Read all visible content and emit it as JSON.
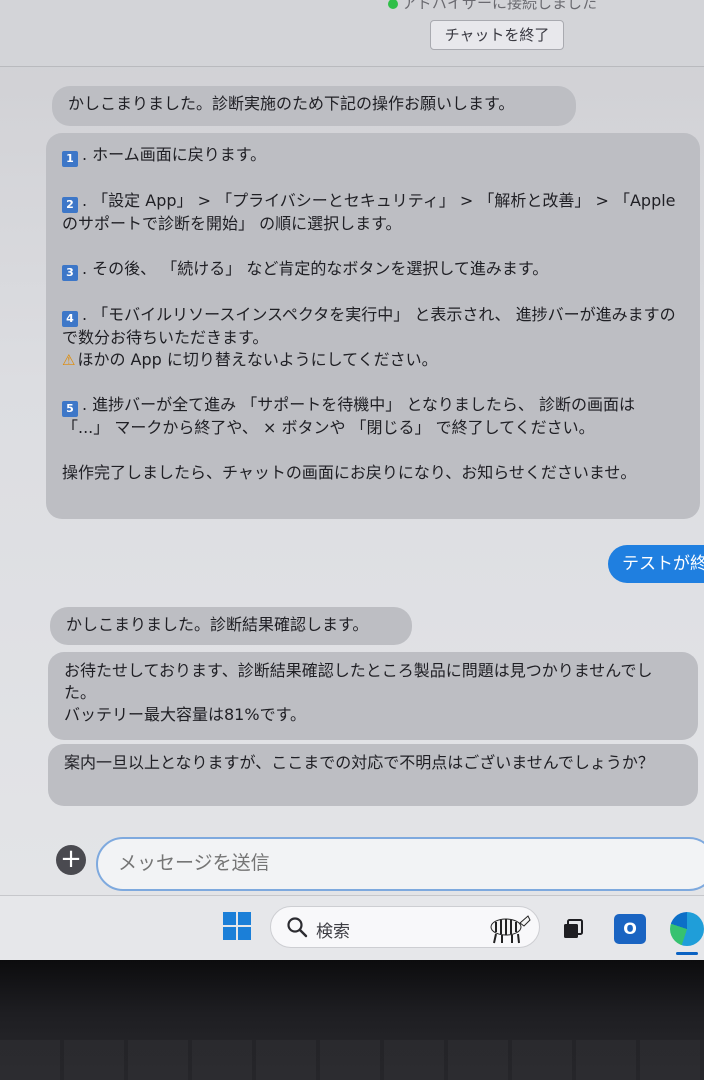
{
  "header": {
    "status_text": "アドバイザーに接続しました",
    "end_chat_label": "チャットを終了"
  },
  "messages": {
    "m1": "かしこまりました。診断実施のため下記の操作お願いします。",
    "steps": {
      "s1": {
        "num": "1",
        "text": ". ホーム画面に戻ります。"
      },
      "s2": {
        "num": "2",
        "text": ". 「設定 App」 > 「プライバシーとセキュリティ」 > 「解析と改善」 > 「Apple のサポートで診断を開始」 の順に選択します。"
      },
      "s3": {
        "num": "3",
        "text": ". その後、 「続ける」 など肯定的なボタンを選択して進みます。"
      },
      "s4": {
        "num": "4",
        "text": ". 「モバイルリソースインスペクタを実行中」 と表示され、 進捗バーが進みますので数分お待ちいただきます。",
        "warning": "ほかの App に切り替えないようにしてください。"
      },
      "s5": {
        "num": "5",
        "text": ". 進捗バーが全て進み 「サポートを待機中」 となりましたら、 診断の画面は 「...」 マークから終了や、 × ボタンや 「閉じる」 で終了してください。"
      },
      "closing": "操作完了しましたら、チャットの画面にお戻りになり、お知らせくださいませ。"
    },
    "user_reply": "テストが終",
    "m3": "かしこまりました。診断結果確認します。",
    "m4_line1": "お待たせしております、診断結果確認したところ製品に問題は見つかりませんでした。",
    "m4_line2": "バッテリー最大容量は81%です。",
    "m5": "案内一旦以上となりますが、ここまでの対応で不明点はございませんでしょうか？"
  },
  "composer": {
    "placeholder": "メッセージを送信"
  },
  "taskbar": {
    "search_label": "検索"
  },
  "colors": {
    "accent": "#1f7fe0",
    "bubble_gray": "#bdbec3",
    "step_badge": "#3d77c8"
  }
}
